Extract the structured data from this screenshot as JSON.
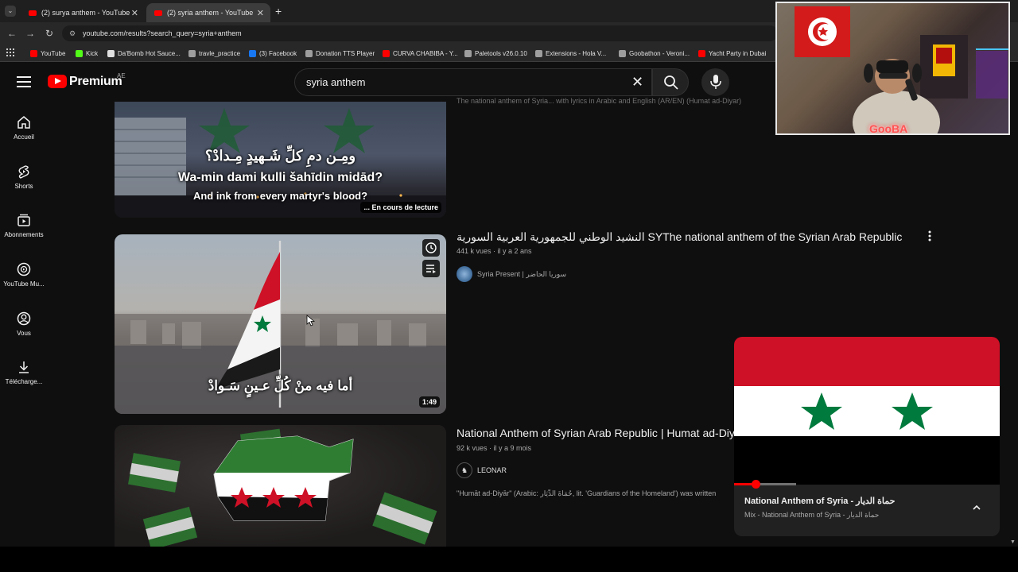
{
  "browser": {
    "tabs": [
      {
        "title": "(2) surya anthem - YouTube",
        "active": false
      },
      {
        "title": "(2) syria anthem - YouTube",
        "active": true
      }
    ],
    "url": "youtube.com/results?search_query=syria+anthem",
    "bookmarks": [
      {
        "label": "YouTube",
        "color": "#ff0000"
      },
      {
        "label": "Kick",
        "color": "#53fc18"
      },
      {
        "label": "Da'Bomb Hot Sauce...",
        "color": "#e0e0e0"
      },
      {
        "label": "travle_practice",
        "color": "#9e9e9e"
      },
      {
        "label": "(3) Facebook",
        "color": "#1877f2"
      },
      {
        "label": "Donation TTS Player",
        "color": "#9e9e9e"
      },
      {
        "label": "CURVA CHABIBA - Y...",
        "color": "#ff0000"
      },
      {
        "label": "Paletools v26.0.10",
        "color": "#9e9e9e"
      },
      {
        "label": "Extensions - Hola V...",
        "color": "#9e9e9e"
      },
      {
        "label": "Goobathon - Veroni...",
        "color": "#9e9e9e"
      },
      {
        "label": "Yacht Party in Dubai",
        "color": "#ff0000"
      }
    ]
  },
  "header": {
    "brand": "Premium",
    "region": "AE",
    "search_query": "syria anthem"
  },
  "sidebar": [
    {
      "label": "Accueil",
      "icon": "home-icon"
    },
    {
      "label": "Shorts",
      "icon": "shorts-icon"
    },
    {
      "label": "Abonnements",
      "icon": "subscriptions-icon"
    },
    {
      "label": "YouTube Mu...",
      "icon": "youtube-music-icon"
    },
    {
      "label": "Vous",
      "icon": "account-icon"
    },
    {
      "label": "Téléchargе...",
      "icon": "download-icon"
    }
  ],
  "results": [
    {
      "snippet": "The national anthem of Syria... with lyrics in Arabic and English (AR/EN) (Humat ad-Diyar)",
      "overlay_arabic": "ومِـن دمِ كلِّ شَـهيدٍ مِـدادْ؟",
      "overlay_translit": "Wa-min dami kulli šahīdin midād?",
      "overlay_english": "And ink from every martyr's blood?",
      "badge": "... En cours de lecture"
    },
    {
      "title": "النشيد الوطني للجمهورية العربية السورية SYThe national anthem of the Syrian Arab Republic SY",
      "views": "441 k vues",
      "age": "il y a 2 ans",
      "channel": "Syria Present | سوريا الحاضر",
      "overlay_arabic": "أما فيه منْ كُلِّ عـينٍ سَـوادْ",
      "duration": "1:49"
    },
    {
      "title": "National Anthem of Syrian Arab Republic | Humat ad-Diyar",
      "views": "92 k vues",
      "age": "il y a 9 mois",
      "channel": "LEONAR",
      "snippet": "\"Humāt ad-Diyār\" (Arabic: حُمَاةَ الدِّيَار, lit. 'Guardians of the Homeland') was written"
    }
  ],
  "webcam": {
    "overlay_name": "GooBA"
  },
  "miniplayer": {
    "title": "National Anthem of Syria - حماة الديار",
    "subtitle": "Mix - National Anthem of Syria - حماة الديار",
    "progress": 0.08
  },
  "colors": {
    "accent": "#ff0000",
    "syria_red": "#ce1126",
    "syria_green": "#007a3d"
  }
}
